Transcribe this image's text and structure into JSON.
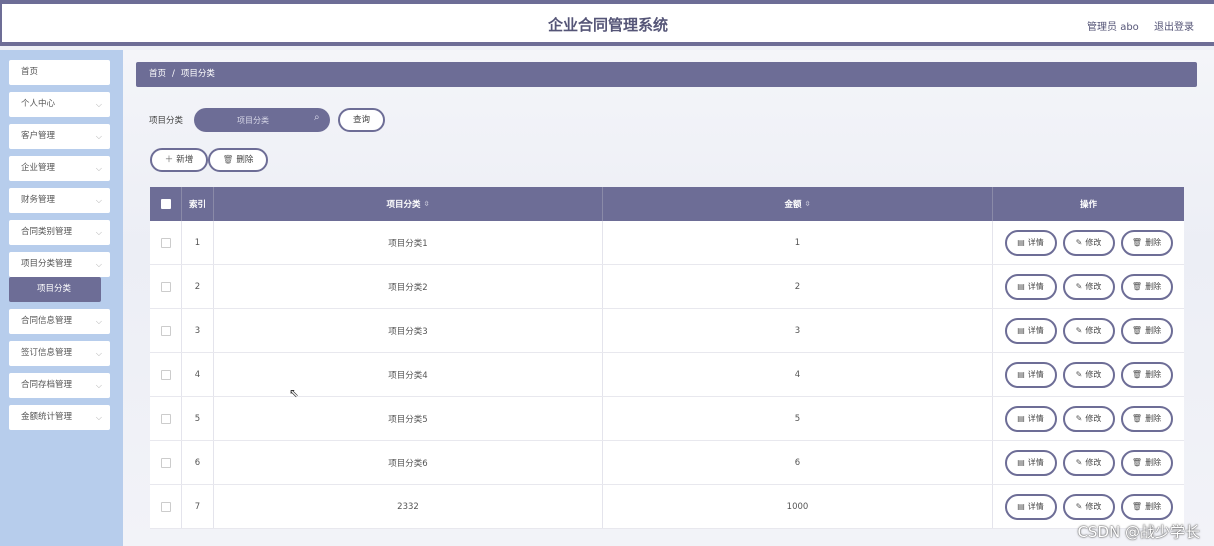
{
  "header": {
    "title": "企业合同管理系统",
    "user_label": "管理员 abo",
    "logout_label": "退出登录"
  },
  "sidebar": {
    "items": [
      {
        "label": "首页",
        "has_chevron": false
      },
      {
        "label": "个人中心",
        "has_chevron": true
      },
      {
        "label": "客户管理",
        "has_chevron": true
      },
      {
        "label": "企业管理",
        "has_chevron": true
      },
      {
        "label": "财务管理",
        "has_chevron": true
      },
      {
        "label": "合同类别管理",
        "has_chevron": true
      },
      {
        "label": "项目分类管理",
        "has_chevron": true
      },
      {
        "label": "项目分类",
        "active_sub": true
      },
      {
        "label": "合同信息管理",
        "has_chevron": true
      },
      {
        "label": "签订信息管理",
        "has_chevron": true
      },
      {
        "label": "合同存档管理",
        "has_chevron": true
      },
      {
        "label": "金额统计管理",
        "has_chevron": true
      }
    ]
  },
  "breadcrumb": {
    "home": "首页",
    "separator": "/",
    "current": "项目分类"
  },
  "search": {
    "label": "项目分类",
    "placeholder": "项目分类",
    "query_button": "查询"
  },
  "actions": {
    "add": "新增",
    "delete": "删除"
  },
  "table": {
    "headers": {
      "index": "索引",
      "category": "项目分类",
      "amount": "金额",
      "operation": "操作"
    },
    "rows": [
      {
        "index": "1",
        "category": "项目分类1",
        "amount": "1"
      },
      {
        "index": "2",
        "category": "项目分类2",
        "amount": "2"
      },
      {
        "index": "3",
        "category": "项目分类3",
        "amount": "3"
      },
      {
        "index": "4",
        "category": "项目分类4",
        "amount": "4"
      },
      {
        "index": "5",
        "category": "项目分类5",
        "amount": "5"
      },
      {
        "index": "6",
        "category": "项目分类6",
        "amount": "6"
      },
      {
        "index": "7",
        "category": "2332",
        "amount": "1000"
      }
    ],
    "row_buttons": {
      "detail": "详情",
      "edit": "修改",
      "delete": "删除"
    }
  },
  "watermark": "CSDN @战少学长",
  "colors": {
    "accent": "#6d6d96",
    "sidebar_bg": "#b7cdec"
  }
}
